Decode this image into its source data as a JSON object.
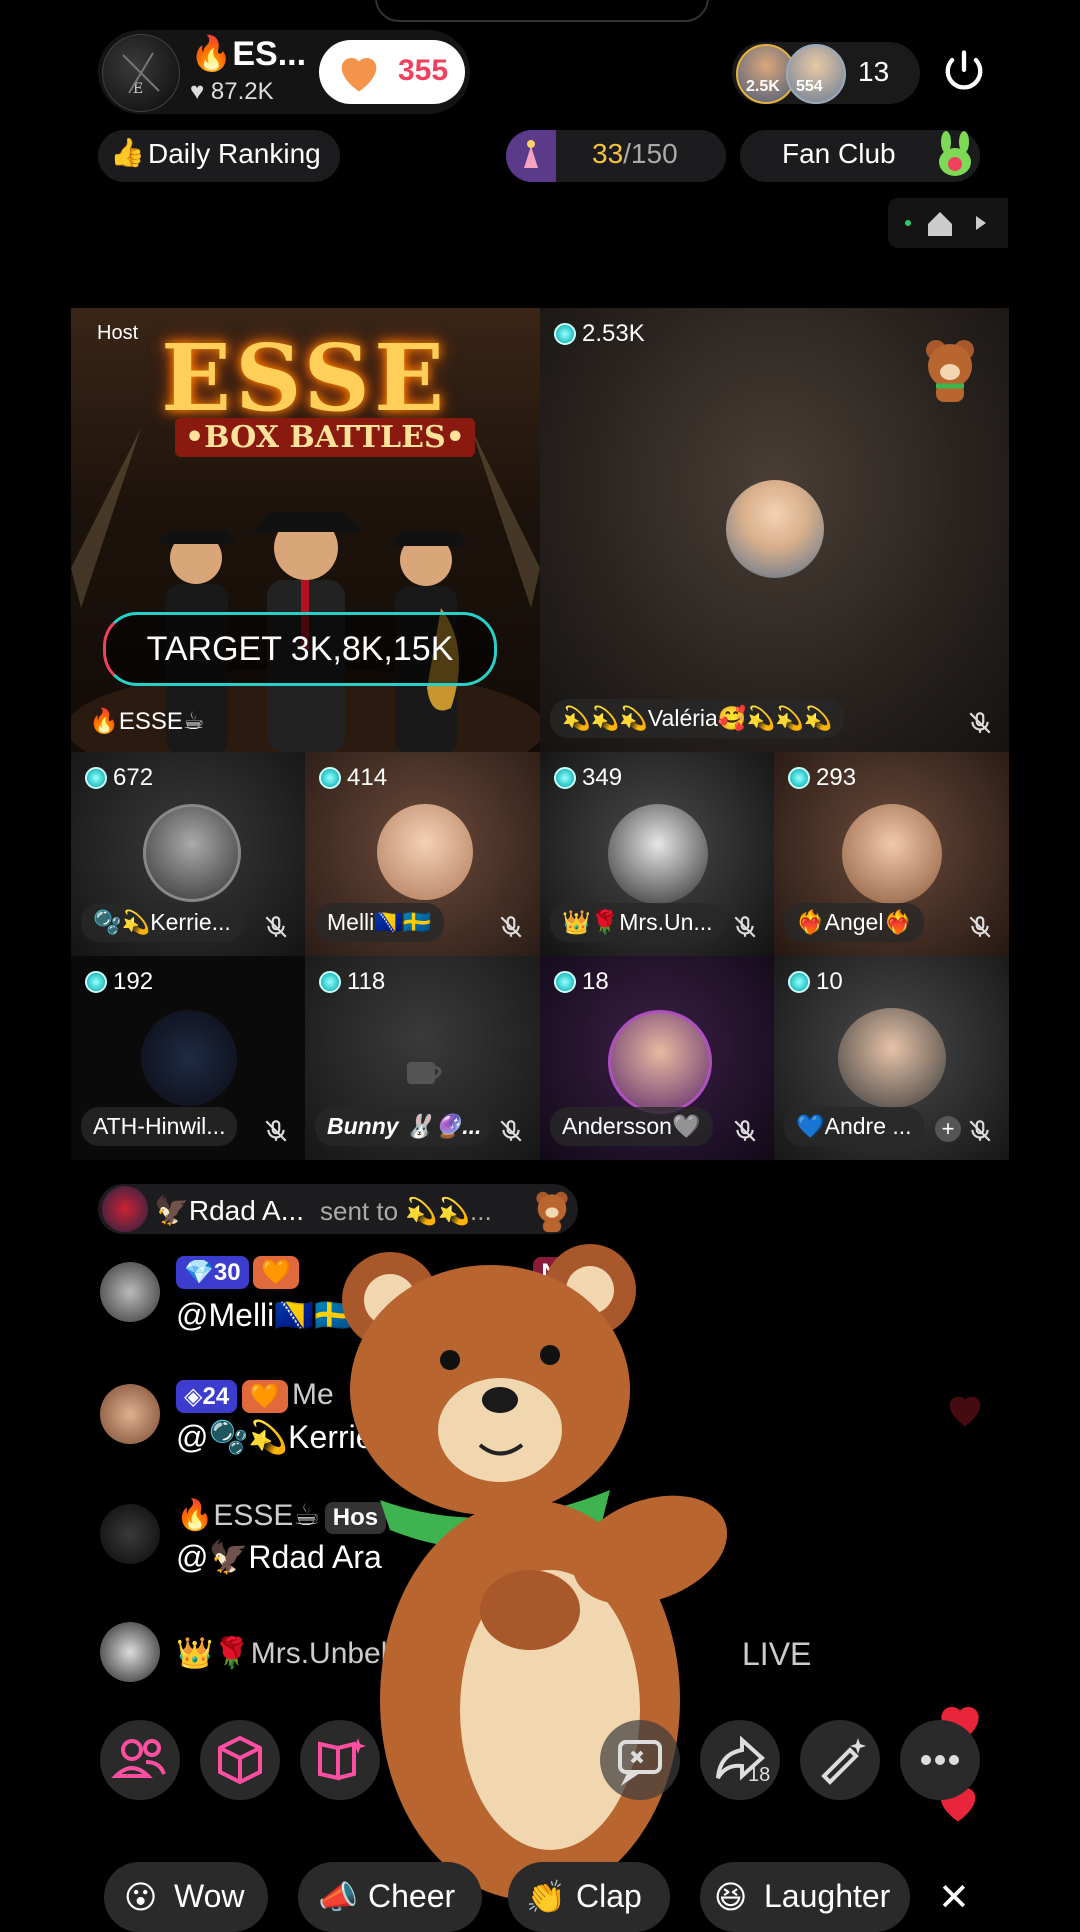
{
  "header": {
    "host_name": "🔥ES...",
    "host_likes": "87.2K",
    "like_count": "355",
    "viewer_badges": [
      "2.5K",
      "554"
    ],
    "viewer_count": "13"
  },
  "subbar": {
    "daily_ranking": "Daily Ranking",
    "progress_current": "33",
    "progress_total": "/150",
    "fan_club": "Fan Club"
  },
  "host_tile": {
    "tag": "Host",
    "poster_title": "ESSE",
    "poster_subtitle": "•BOX BATTLES•",
    "target_text": "TARGET 3K,8K,15K",
    "caption": "🔥ESSE☕"
  },
  "guest_main": {
    "score": "2.53K",
    "name": "💫💫💫Valéria🥰💫💫💫"
  },
  "guests": [
    {
      "score": "672",
      "name": "🫧💫Kerrie..."
    },
    {
      "score": "414",
      "name": "Melli🇧🇦🇸🇪"
    },
    {
      "score": "349",
      "name": "👑🌹Mrs.Un..."
    },
    {
      "score": "293",
      "name": "❤️‍🔥Angel❤️‍🔥"
    },
    {
      "score": "192",
      "name": "ATH-Hinwil..."
    },
    {
      "score": "118",
      "name": "Bunny 🐰🔮..."
    },
    {
      "score": "18",
      "name": "Andersson🩶"
    },
    {
      "score": "10",
      "name": "💙Andre ..."
    }
  ],
  "gift_notice": {
    "sender": "🦅Rdad  A...",
    "text": "sent to 💫💫..."
  },
  "chat": [
    {
      "badge_level": "30",
      "extra": "No. 2",
      "name": "",
      "message": "@Melli🇧🇦🇸🇪 🤣🤣🤣🤣"
    },
    {
      "badge_level": "24",
      "extra": "",
      "name": "Me",
      "message": "@🫧💫Kerrie"
    },
    {
      "badge_level": "",
      "extra": "Hos",
      "name": "🔥ESSE☕",
      "message": "@🦅Rdad  Ara"
    },
    {
      "badge_level": "",
      "extra": "",
      "name": "👑🌹Mrs.Unbekann",
      "message": "LIVE"
    }
  ],
  "toolbar": {
    "share_count": "18"
  },
  "reactions": [
    "Wow",
    "Cheer",
    "Clap",
    "Laughter"
  ],
  "colors": {
    "accent_pink": "#f0425d",
    "accent_teal": "#29d0c8",
    "gold": "#f5c242"
  }
}
